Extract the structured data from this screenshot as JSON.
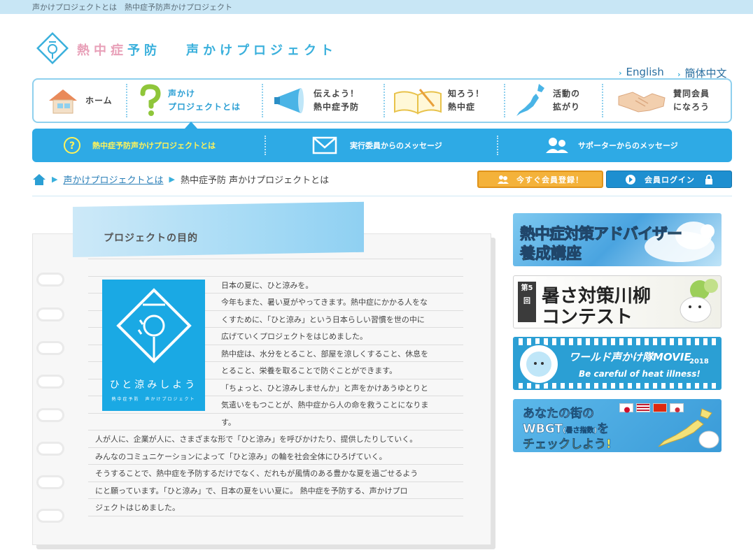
{
  "topbar": {
    "breadcrumb_text": "声かけプロジェクトとは　熱中症予防声かけプロジェクト"
  },
  "header": {
    "brand_pink": "熱中症",
    "brand_blue": "予防",
    "brand_project": "声かけプロジェクト",
    "lang_en": "English",
    "lang_zh": "簡体中文"
  },
  "nav": {
    "home": "ホーム",
    "about_1": "声かけ",
    "about_2": "プロジェクトとは",
    "tell_1": "伝えよう！",
    "tell_2": "熱中症予防",
    "know_1": "知ろう！",
    "know_2": "熱中症",
    "spread_1": "活動の",
    "spread_2": "拡がり",
    "join_1": "賛同会員",
    "join_2": "になろう"
  },
  "subnav": {
    "item1": "熱中症予防声かけプロジェクトとは",
    "item2": "実行委員からのメッセージ",
    "item3": "サポーターからのメッセージ"
  },
  "breadcrumb": {
    "link": "声かけプロジェクトとは",
    "current": "熱中症予防 声かけプロジェクトとは"
  },
  "buttons": {
    "register": "今すぐ会員登録！",
    "login": "会員ログイン"
  },
  "article": {
    "section_title": "プロジェクトの目的",
    "logo_text1": "ひと涼みしよう",
    "logo_text2": "熱中症予防　声かけプロジェクト",
    "lines": [
      "日本の夏に、ひと涼みを。",
      "今年もまた、暑い夏がやってきます。熱中症にかかる人をな",
      "くすために、「ひと涼み」という日本らしい習慣を世の中に",
      "広げていくプロジェクトをはじめました。",
      "熱中症は、水分をとること、部屋を涼しくすること、休息を",
      "とること、栄養を取ることで防ぐことができます。",
      "「ちょっと、ひと涼みしませんか」と声をかけあうゆとりと",
      "気遣いをもつことが、熱中症から人の命を救うことになりま",
      "す。"
    ],
    "wide_lines": [
      "人が人に、企業が人に、さまざまな形で「ひと涼み」を呼びかけたり、提供したりしていく。",
      "みんなのコミュニケーションによって「ひと涼み」の輪を社会全体にひろげていく。",
      "そうすることで、熱中症を予防するだけでなく、だれもが風情のある豊かな夏を過ごせるよう",
      "にと願っています。「ひと涼み」で、日本の夏をいい夏に。 熱中症を予防する、声かけプロ",
      "ジェクトはじめました。"
    ]
  },
  "banners": {
    "b1_line1": "熱中症対策アドバイザー",
    "b1_line2": "養成講座",
    "b2_badge": "第5回",
    "b2_line1": "暑さ対策川柳",
    "b2_line2": "コンテスト",
    "b3_line1": "ワールド声かけ隊MOVIE",
    "b3_year": "2018",
    "b3_line2": "Be careful of heat illness!",
    "b4_line1": "あなたの街の",
    "b4_line2": "WBGT",
    "b4_line2_small": "(暑さ指数)",
    "b4_line2_end": "を",
    "b4_line3": "チェックしよう!"
  },
  "colors": {
    "accent": "#2eaae5",
    "accent_light": "#8fd0ee",
    "highlight": "#fff35a",
    "register": "#f4b23a",
    "login": "#1e8fd0"
  }
}
